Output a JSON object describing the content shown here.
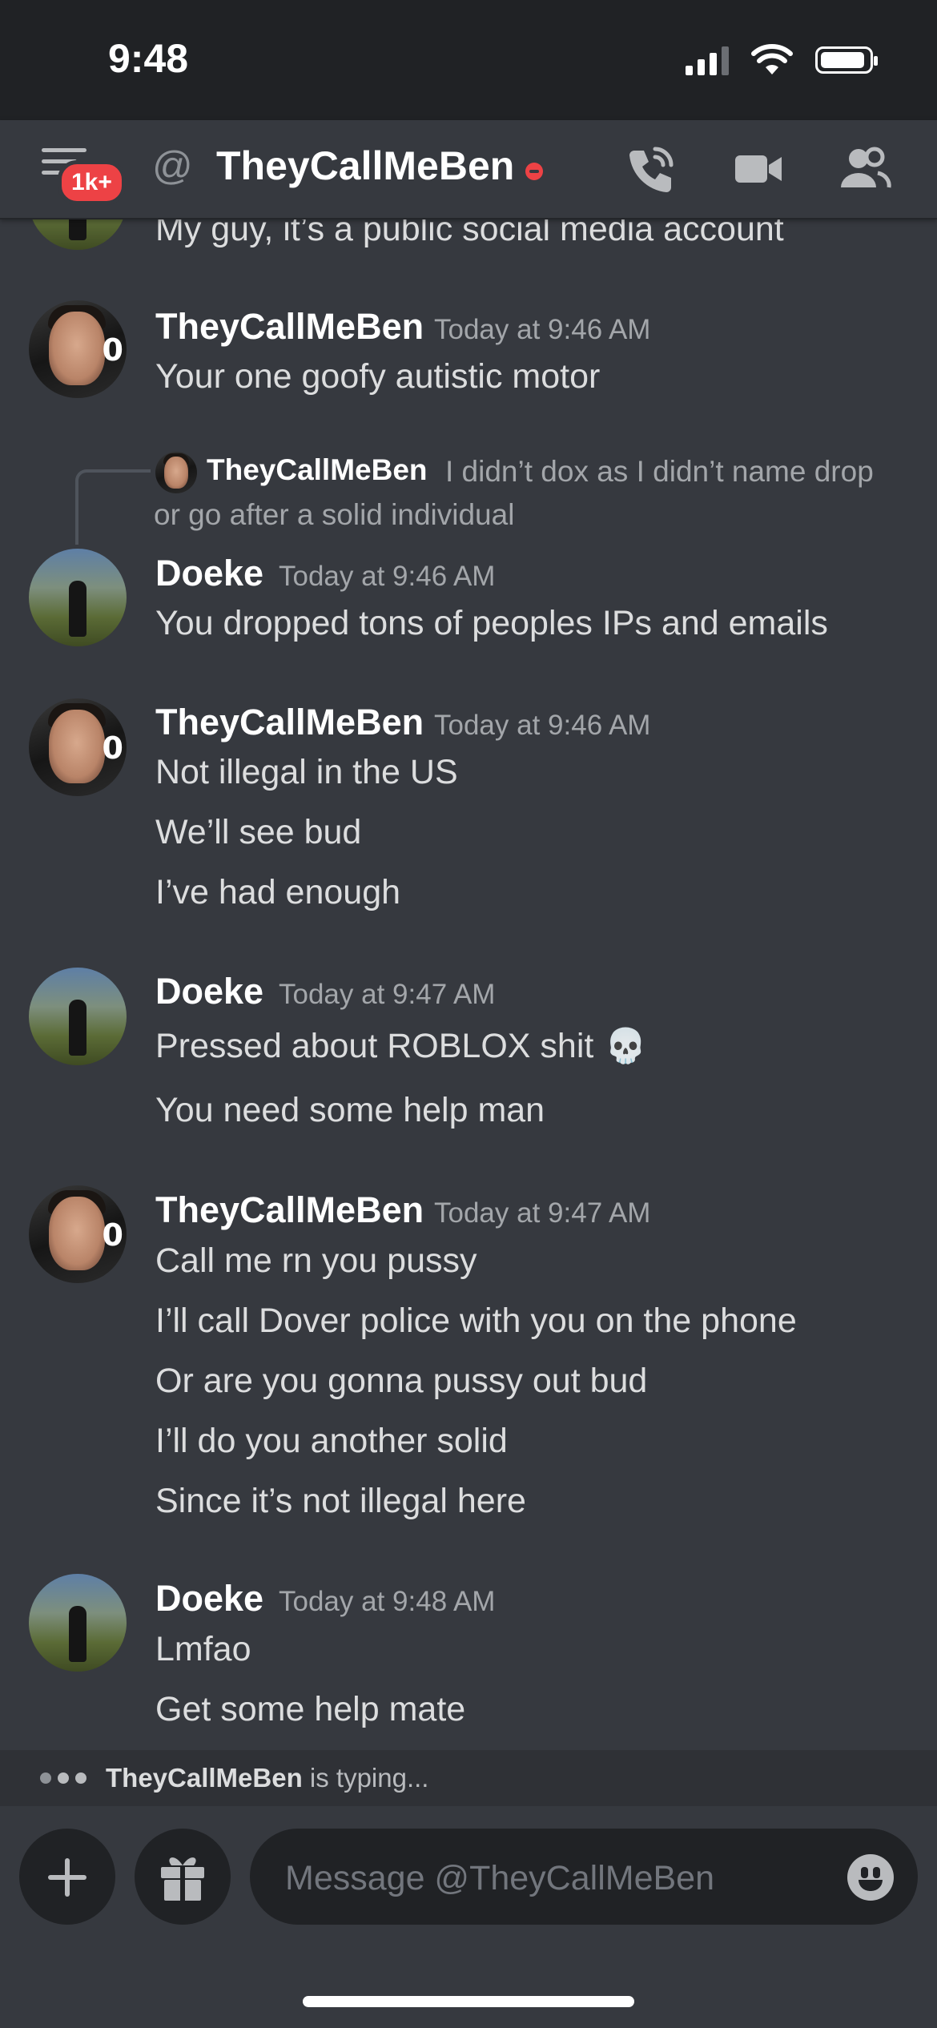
{
  "status_bar": {
    "time": "9:48"
  },
  "header": {
    "badge": "1k+",
    "at_symbol": "@",
    "channel_name": "TheyCallMeBen",
    "icons": [
      "menu-icon",
      "call-icon",
      "video-icon",
      "members-icon"
    ]
  },
  "colors": {
    "background": "#36393f",
    "header": "#202225",
    "dnd": "#ed4245",
    "muted": "#a3a6aa"
  },
  "messages": {
    "top_partial": "My guy, it’s a public social media account",
    "m1": {
      "user": "TheyCallMeBen",
      "time": "Today at 9:46 AM",
      "lines": [
        "Your one goofy autistic motor"
      ]
    },
    "m2": {
      "reply": {
        "user": "TheyCallMeBen",
        "text_line1": "I didn’t dox as I didn’t name drop",
        "text_line2": "or go after a solid individual"
      },
      "user": "Doeke",
      "time": "Today at 9:46 AM",
      "lines": [
        "You dropped tons of peoples IPs and emails"
      ]
    },
    "m3": {
      "user": "TheyCallMeBen",
      "time": "Today at 9:46 AM",
      "lines": [
        "Not illegal in the US",
        "We’ll see bud",
        "I’ve had enough"
      ]
    },
    "m4": {
      "user": "Doeke",
      "time": "Today at 9:47 AM",
      "lines": [
        "Pressed about ROBLOX shit",
        "You need some help man"
      ],
      "emoji": "💀"
    },
    "m5": {
      "user": "TheyCallMeBen",
      "time": "Today at 9:47 AM",
      "lines": [
        "Call me rn you pussy",
        "I’ll call Dover police with you on the phone",
        "Or are you gonna pussy out bud",
        "I’ll do you another solid",
        "Since it’s not illegal here"
      ]
    },
    "m6": {
      "user": "Doeke",
      "time": "Today at 9:48 AM",
      "lines": [
        "Lmfao",
        "Get some help mate"
      ]
    }
  },
  "typing": {
    "user": "TheyCallMeBen",
    "suffix": " is typing..."
  },
  "composer": {
    "placeholder": "Message @TheyCallMeBen"
  }
}
